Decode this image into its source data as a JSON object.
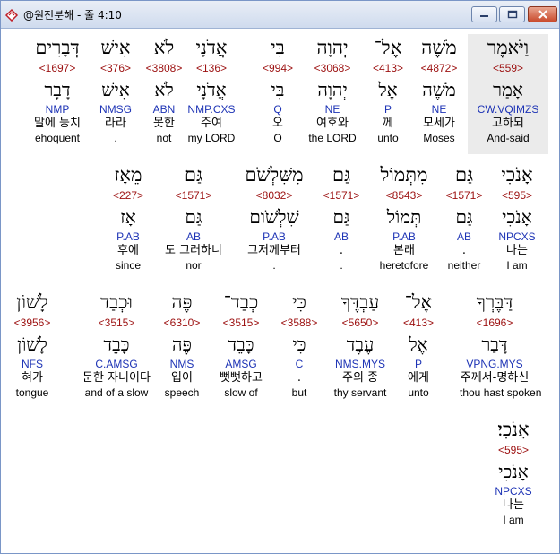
{
  "window": {
    "title": "@원전분해 - 줄 4:10",
    "icon": "book-app-icon",
    "controls": [
      "minimize-icon",
      "maximize-icon",
      "close-icon"
    ]
  },
  "colors": {
    "strong_number": "#9c1010",
    "morphology": "#1d33b5",
    "selected_background": "#ebebeb"
  },
  "selected_word_index": 0,
  "lines": [
    {
      "words": [
        {
          "heb": "וַיֹּאמֶר",
          "strong": "<559>",
          "lemma": "אָמַר",
          "morph": "CW.VQIMZS",
          "kor": "고하되",
          "eng": "And-said"
        },
        {
          "heb": "מֹשֶׁה",
          "strong": "<4872>",
          "lemma": "מֹשֶׁה",
          "morph": "NE",
          "kor": "모세가",
          "eng": "Moses"
        },
        {
          "heb": "אֶל־",
          "strong": "<413>",
          "lemma": "אֶל",
          "morph": "P",
          "kor": "께",
          "eng": "unto"
        },
        {
          "heb": "יְהוָה",
          "strong": "<3068>",
          "lemma": "יְהוָה",
          "morph": "NE",
          "kor": "여호와",
          "eng": "the LORD"
        },
        {
          "heb": "בִּי",
          "strong": "<994>",
          "lemma": "בִּי",
          "morph": "Q",
          "kor": "오",
          "eng": "O"
        },
        {
          "heb": "אֲדֹנָי",
          "strong": "<136>",
          "lemma": "אֲדֹנָי",
          "morph": "NMP.CXS",
          "kor": "주여",
          "eng": "my LORD"
        },
        {
          "heb": "לֹא",
          "strong": "<3808>",
          "lemma": "לֹא",
          "morph": "ABN",
          "kor": "못한",
          "eng": "not"
        },
        {
          "heb": "אִישׁ",
          "strong": "<376>",
          "lemma": "אִישׁ",
          "morph": "NMSG",
          "kor": "라라",
          "eng": "."
        },
        {
          "heb": "דְּבָרִים",
          "strong": "<1697>",
          "lemma": "דָּבָר",
          "morph": "NMP",
          "kor": "말에 능치",
          "eng": "ehoquent"
        }
      ]
    },
    {
      "words": [
        {
          "heb": "אָנֹכִי",
          "strong": "<595>",
          "lemma": "אָנֹכִי",
          "morph": "NPCXS",
          "kor": "나는",
          "eng": "I am"
        },
        {
          "heb": "גַּם",
          "strong": "<1571>",
          "lemma": "גַּם",
          "morph": "AB",
          "kor": ".",
          "eng": "neither"
        },
        {
          "heb": "מִתְּמוֹל",
          "strong": "<8543>",
          "lemma": "תְּמוֹל",
          "morph": "P.AB",
          "kor": "본래",
          "eng": "heretofore"
        },
        {
          "heb": "גַּם",
          "strong": "<1571>",
          "lemma": "גַּם",
          "morph": "AB",
          "kor": ".",
          "eng": "."
        },
        {
          "heb": "מִשִּׁלְשֹׁם",
          "strong": "<8032>",
          "lemma": "שִׁלְשֹׁום",
          "morph": "P.AB",
          "kor": "그저께부터",
          "eng": "."
        },
        {
          "heb": "גַּם",
          "strong": "<1571>",
          "lemma": "גַּם",
          "morph": "AB",
          "kor": "도 그러하니",
          "eng": "nor"
        },
        {
          "heb": "מֵאָז",
          "strong": "<227>",
          "lemma": "אָז",
          "morph": "P.AB",
          "kor": "후에",
          "eng": "since"
        }
      ]
    },
    {
      "words": [
        {
          "heb": "דַּבֶּרְךָ",
          "strong": "<1696>",
          "lemma": "דָּבַר",
          "morph": "VPNG.MYS",
          "kor": "주께서-명하신",
          "eng": "thou hast spoken"
        },
        {
          "heb": "אֶל־",
          "strong": "<413>",
          "lemma": "אֶל",
          "morph": "P",
          "kor": "에게",
          "eng": "unto"
        },
        {
          "heb": "עַבְדֶּךָ",
          "strong": "<5650>",
          "lemma": "עֶבֶד",
          "morph": "NMS.MYS",
          "kor": "주의 종",
          "eng": "thy servant"
        },
        {
          "heb": "כִּי",
          "strong": "<3588>",
          "lemma": "כִּי",
          "morph": "C",
          "kor": ".",
          "eng": "but"
        },
        {
          "heb": "כְבַד־",
          "strong": "<3515>",
          "lemma": "כָּבֵד",
          "morph": "AMSG",
          "kor": "뻣뻣하고",
          "eng": "slow of"
        },
        {
          "heb": "פֶּה",
          "strong": "<6310>",
          "lemma": "פֶּה",
          "morph": "NMS",
          "kor": "입이",
          "eng": "speech"
        },
        {
          "heb": "וּכְבַד",
          "strong": "<3515>",
          "lemma": "כָּבֵד",
          "morph": "C.AMSG",
          "kor": "둔한 자니이다",
          "eng": "and of a slow"
        },
        {
          "heb": "לָשׁוֹן",
          "strong": "<3956>",
          "lemma": "לָשׁוֹן",
          "morph": "NFS",
          "kor": "혀가",
          "eng": "tongue"
        }
      ]
    },
    {
      "words": [
        {
          "heb": "אָנֹכִי׃",
          "strong": "<595>",
          "lemma": "אָנֹכִי",
          "morph": "NPCXS",
          "kor": "나는",
          "eng": "I am"
        }
      ]
    }
  ]
}
